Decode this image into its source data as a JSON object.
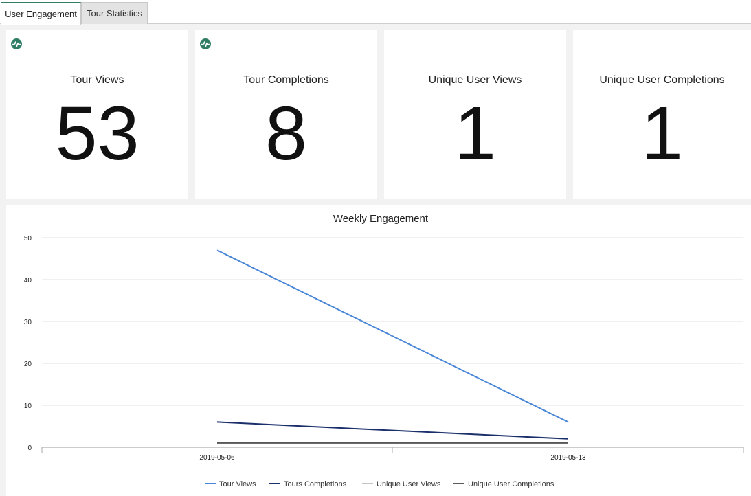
{
  "tabs": [
    {
      "label": "User Engagement",
      "active": true
    },
    {
      "label": "Tour Statistics",
      "active": false
    }
  ],
  "cards": [
    {
      "label": "Tour Views",
      "value": "53",
      "icon": "pulse-icon"
    },
    {
      "label": "Tour Completions",
      "value": "8",
      "icon": "pulse-icon"
    },
    {
      "label": "Unique User Views",
      "value": "1"
    },
    {
      "label": "Unique User Completions",
      "value": "1"
    }
  ],
  "colors": {
    "accent": "#2e7d64",
    "tour_views": "#4a86d8",
    "tours_completions": "#1b2f6b",
    "unique_user_views": "#c4c4c4",
    "unique_user_completions": "#5a5a5a"
  },
  "chart_data": {
    "type": "line",
    "title": "Weekly Engagement",
    "x": [
      "2019-05-06",
      "2019-05-13"
    ],
    "ylim": [
      0,
      50
    ],
    "yticks": [
      0,
      10,
      20,
      30,
      40,
      50
    ],
    "grid": true,
    "legend_position": "bottom",
    "series": [
      {
        "name": "Tour Views",
        "values": [
          47,
          6
        ],
        "color": "#4a86d8"
      },
      {
        "name": "Tours Completions",
        "values": [
          6,
          2
        ],
        "color": "#1b2f6b"
      },
      {
        "name": "Unique User Views",
        "values": [
          1,
          1
        ],
        "color": "#c4c4c4"
      },
      {
        "name": "Unique User Completions",
        "values": [
          1,
          1
        ],
        "color": "#5a5a5a"
      }
    ]
  }
}
